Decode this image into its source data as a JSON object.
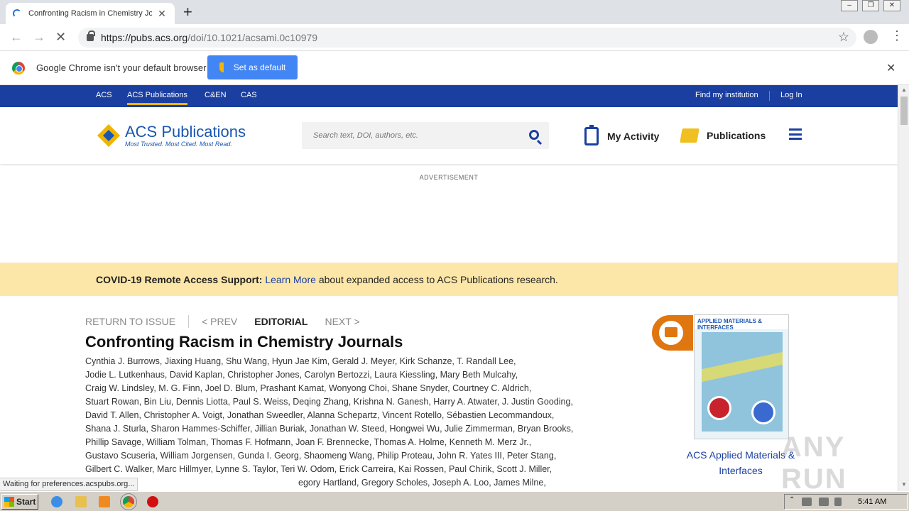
{
  "browser": {
    "tab_title": "Confronting Racism in Chemistry Jou",
    "url_host": "https://pubs.acs.org",
    "url_path": "/doi/10.1021/acsami.0c10979",
    "infobar_text": "Google Chrome isn't your default browser",
    "set_default_label": "Set as default",
    "status_text": "Waiting for preferences.acspubs.org..."
  },
  "topnav": {
    "items": [
      "ACS",
      "ACS Publications",
      "C&EN",
      "CAS"
    ],
    "find_institution": "Find my institution",
    "login": "Log In"
  },
  "header": {
    "logo_text": "ACS Publications",
    "tagline": "Most Trusted. Most Cited. Most Read.",
    "search_placeholder": "Search text, DOI, authors, etc.",
    "my_activity": "My Activity",
    "publications": "Publications"
  },
  "advertisement_label": "ADVERTISEMENT",
  "covid": {
    "bold": "COVID-19 Remote Access Support:",
    "link": "Learn More",
    "rest": "about expanded access to ACS Publications research."
  },
  "article_nav": {
    "return": "RETURN TO ISSUE",
    "prev": "< PREV",
    "type": "EDITORIAL",
    "next": "NEXT >"
  },
  "article": {
    "title": "Confronting Racism in Chemistry Journals",
    "author_lines": [
      "Cynthia J. Burrows, Jiaxing Huang, Shu Wang, Hyun Jae Kim, Gerald J. Meyer, Kirk Schanze, T. Randall Lee,",
      "Jodie L. Lutkenhaus, David Kaplan, Christopher Jones, Carolyn Bertozzi, Laura Kiessling, Mary Beth Mulcahy,",
      "Craig W. Lindsley, M. G. Finn, Joel D. Blum, Prashant Kamat, Wonyong Choi, Shane Snyder, Courtney C. Aldrich,",
      "Stuart Rowan, Bin Liu, Dennis Liotta, Paul S. Weiss, Deqing Zhang, Krishna N. Ganesh, Harry A. Atwater, J. Justin Gooding,",
      "David T. Allen, Christopher A. Voigt, Jonathan Sweedler, Alanna Schepartz, Vincent Rotello, Sébastien Lecommandoux,",
      "Shana J. Sturla, Sharon Hammes-Schiffer, Jillian Buriak, Jonathan W. Steed, Hongwei Wu, Julie Zimmerman, Bryan Brooks,",
      "Phillip Savage, William Tolman, Thomas F. Hofmann, Joan F. Brennecke, Thomas A. Holme, Kenneth M. Merz Jr.,",
      "Gustavo Scuseria, William Jorgensen, Gunda I. Georg, Shaomeng Wang, Philip Proteau, John R. Yates III, Peter Stang,",
      "Gilbert C. Walker, Marc Hillmyer, Lynne S. Taylor, Teri W. Odom, Erick Carreira, Kai Rossen, Paul Chirik, Scott J. Miller,",
      "egory Hartland, Gregory Scholes, Joseph A. Loo, James Milne,"
    ]
  },
  "sidebar": {
    "cover_title": "APPLIED MATERIALS & INTERFACES",
    "journal_name": "ACS Applied Materials & Interfaces"
  },
  "watermark": "ANY RUN",
  "taskbar": {
    "start_label": "Start",
    "clock": "5:41 AM"
  }
}
